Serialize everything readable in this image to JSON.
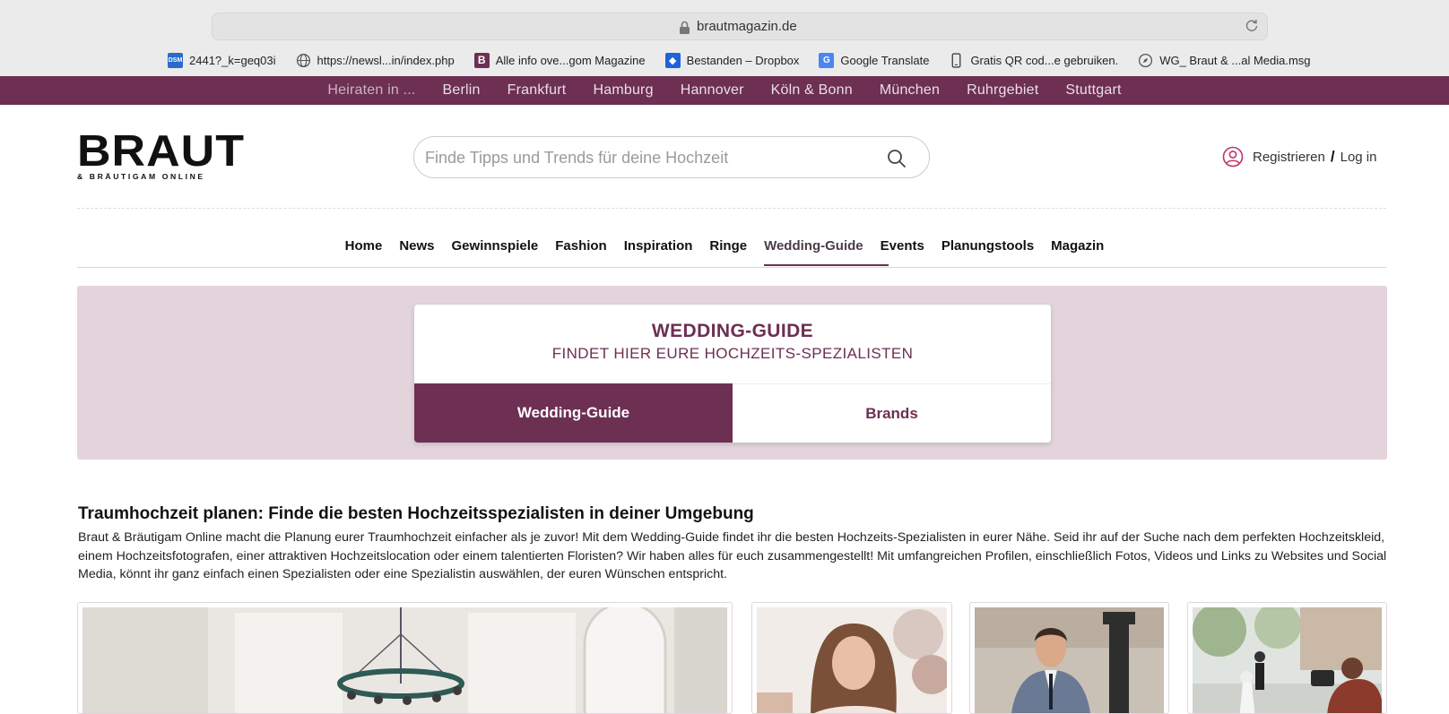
{
  "browser": {
    "url": "brautmagazin.de",
    "bookmarks": [
      {
        "label": "2441?_k=geq03i",
        "icon": "dsm-icon"
      },
      {
        "label": "https://newsl...in/index.php",
        "icon": "globe-icon"
      },
      {
        "label": "Alle info ove...gom Magazine",
        "icon": "b-logo-icon"
      },
      {
        "label": "Bestanden – Dropbox",
        "icon": "dropbox-icon"
      },
      {
        "label": "Google Translate",
        "icon": "translate-icon"
      },
      {
        "label": "Gratis QR cod...e gebruiken.",
        "icon": "phone-icon"
      },
      {
        "label": "WG_ Braut & ...al Media.msg",
        "icon": "compass-icon"
      }
    ]
  },
  "citybar": {
    "intro": "Heiraten in ...",
    "cities": [
      "Berlin",
      "Frankfurt",
      "Hamburg",
      "Hannover",
      "Köln & Bonn",
      "München",
      "Ruhrgebiet",
      "Stuttgart"
    ]
  },
  "header": {
    "logo_main": "BRAUT",
    "logo_sub": "& BRÄUTIGAM ONLINE",
    "search_placeholder": "Finde Tipps und Trends für deine Hochzeit",
    "register": "Registrieren",
    "slash": "/",
    "login": "Log in"
  },
  "nav": {
    "items": [
      "Home",
      "News",
      "Gewinnspiele",
      "Fashion",
      "Inspiration",
      "Ringe",
      "Wedding-Guide",
      "Events",
      "Planungstools",
      "Magazin"
    ],
    "active": "Wedding-Guide"
  },
  "hero": {
    "title": "WEDDING-GUIDE",
    "subtitle": "FINDET HIER EURE HOCHZEITS-SPEZIALISTEN",
    "tab_guide": "Wedding-Guide",
    "tab_brands": "Brands"
  },
  "intro": {
    "heading": "Traumhochzeit planen: Finde die besten Hochzeitsspezialisten in deiner Umgebung",
    "text": "Braut & Bräutigam Online macht die Planung eurer Traumhochzeit einfacher als je zuvor! Mit dem Wedding-Guide findet ihr die besten Hochzeits-Spezialisten in eurer Nähe. Seid ihr auf der Suche nach dem perfekten Hochzeitskleid, einem Hochzeitsfotografen, einer attraktiven Hochzeitslocation oder einem talentierten Floristen? Wir haben alles für euch zusammengestellt! Mit umfangreichen Profilen, einschließlich Fotos, Videos und Links zu Websites und Social Media, könnt ihr ganz einfach einen Spezialisten oder eine Spezialistin auswählen, der euren Wünschen entspricht."
  },
  "colors": {
    "brand": "#6d2f52",
    "hero_bg": "#e3d4dc"
  }
}
